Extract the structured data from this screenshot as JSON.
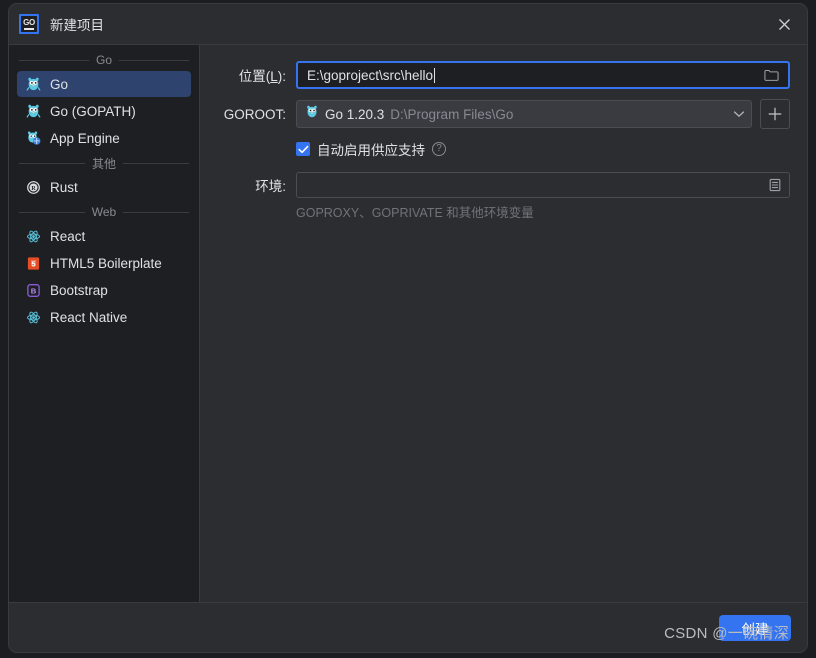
{
  "window": {
    "title": "新建项目",
    "app_icon": "go-logo-icon",
    "close_icon": "close-icon",
    "accent_color": "#3574f0",
    "background_color": "#2b2d30",
    "sidebar_background": "#1e1f22",
    "selection_color": "#2e436e"
  },
  "sidebar": {
    "sections": [
      {
        "label": "Go",
        "items": [
          {
            "label": "Go",
            "icon": "gopher-icon",
            "selected": true
          },
          {
            "label": "Go (GOPATH)",
            "icon": "gopher-icon",
            "selected": false
          },
          {
            "label": "App Engine",
            "icon": "app-engine-icon",
            "selected": false
          }
        ]
      },
      {
        "label": "其他",
        "items": [
          {
            "label": "Rust",
            "icon": "rust-icon",
            "selected": false
          }
        ]
      },
      {
        "label": "Web",
        "items": [
          {
            "label": "React",
            "icon": "react-icon",
            "selected": false
          },
          {
            "label": "HTML5 Boilerplate",
            "icon": "html5-icon",
            "selected": false
          },
          {
            "label": "Bootstrap",
            "icon": "bootstrap-icon",
            "selected": false
          },
          {
            "label": "React Native",
            "icon": "react-icon",
            "selected": false
          }
        ]
      }
    ]
  },
  "form": {
    "location": {
      "label_prefix": "位置(",
      "label_mnemonic": "L",
      "label_suffix": "):",
      "value": "E:\\goproject\\src\\hello",
      "placeholder": "",
      "browse_icon": "folder-icon"
    },
    "goroot": {
      "label": "GOROOT:",
      "sdk_icon": "gopher-icon",
      "sdk_name": "Go 1.20.3",
      "sdk_path": "D:\\Program Files\\Go",
      "dropdown_icon": "chevron-down-icon",
      "add_icon": "plus-icon",
      "add_label": "+"
    },
    "vendoring": {
      "label": "自动启用供应支持",
      "checked": true,
      "check_icon": "checkmark-icon",
      "help_icon": "question-mark-icon",
      "help_label": "?"
    },
    "environment": {
      "label": "环境:",
      "value": "",
      "placeholder": "",
      "expand_icon": "list-editor-icon",
      "hint": "GOPROXY、GOPRIVATE 和其他环境变量"
    }
  },
  "footer": {
    "create_label": "创建",
    "watermark": "CSDN @一碗情深"
  }
}
